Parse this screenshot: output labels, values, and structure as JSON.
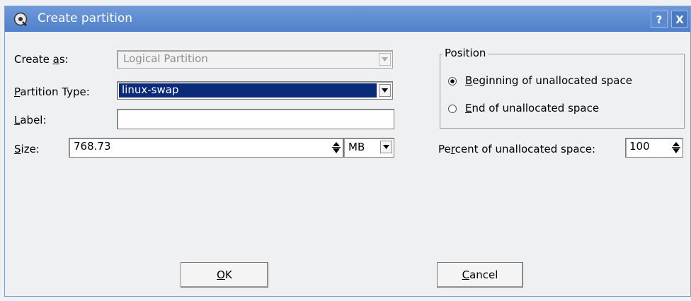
{
  "window": {
    "title": "Create partition",
    "help_label": "?",
    "close_label": "X"
  },
  "form": {
    "create_as": {
      "prefix": "Create ",
      "mnemonic": "a",
      "suffix": "s:",
      "value": "Logical Partition"
    },
    "partition_type": {
      "mnemonic": "P",
      "suffix": "artition Type:",
      "value": "linux-swap"
    },
    "label": {
      "mnemonic": "L",
      "suffix": "abel:",
      "value": ""
    },
    "size": {
      "mnemonic": "S",
      "suffix": "ize:",
      "value": "768.73",
      "unit": "MB"
    }
  },
  "position": {
    "legend": "Position",
    "options": [
      {
        "mnemonic": "B",
        "suffix": "eginning of unallocated space",
        "selected": true
      },
      {
        "mnemonic": "E",
        "suffix": "nd of unallocated space",
        "selected": false
      }
    ]
  },
  "percent": {
    "prefix": "Pe",
    "mnemonic": "r",
    "suffix": "cent of unallocated space:",
    "value": "100"
  },
  "buttons": {
    "ok": {
      "mnemonic": "O",
      "suffix": "K"
    },
    "cancel": {
      "mnemonic": "C",
      "suffix": "ancel"
    }
  },
  "icons": {
    "app": "disk-icon",
    "dropdown": "dropdown-arrow-icon",
    "spin": "spin-arrows-icon"
  },
  "colors": {
    "titlebar": "#4f80c9",
    "selection": "#0a2a7a"
  }
}
